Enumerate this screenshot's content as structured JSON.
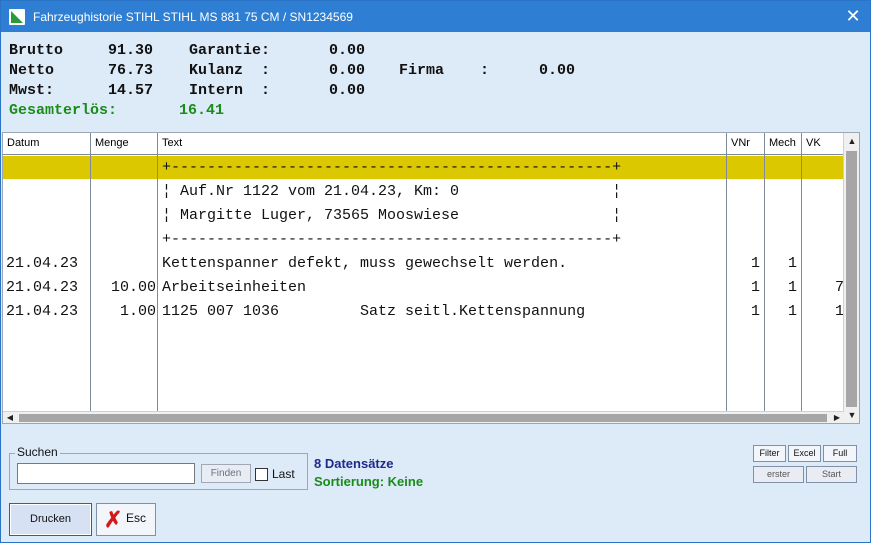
{
  "window": {
    "title": "Fahrzeughistorie STIHL STIHL MS 881 75 CM / SN1234569",
    "close_symbol": "✕"
  },
  "summary": {
    "brutto_label": "Brutto",
    "brutto_value": "91.30",
    "netto_label": "Netto",
    "netto_value": "76.73",
    "mwst_label": "Mwst:",
    "mwst_value": "14.57",
    "garantie_label": "Garantie:",
    "garantie_value": "0.00",
    "kulanz_label": "Kulanz  :",
    "kulanz_value": "0.00",
    "intern_label": "Intern  :",
    "intern_value": "0.00",
    "firma_label": "Firma    :",
    "firma_value": "0.00",
    "gesamterloes_label": "Gesamterlös:",
    "gesamterloes_value": "16.41"
  },
  "table": {
    "columns": [
      "Datum",
      "Menge",
      "Text",
      "VNr",
      "Mech",
      "VK"
    ],
    "rows": [
      {
        "datum": "",
        "menge": "",
        "text": "+-------------------------------------------------+",
        "vnr": "",
        "mech": "",
        "vk": ""
      },
      {
        "datum": "",
        "menge": "",
        "text": "¦ Auf.Nr 1122 vom 21.04.23, Km: 0                 ¦",
        "vnr": "",
        "mech": "",
        "vk": ""
      },
      {
        "datum": "",
        "menge": "",
        "text": "¦ Margitte Luger, 73565 Mooswiese                 ¦",
        "vnr": "",
        "mech": "",
        "vk": ""
      },
      {
        "datum": "",
        "menge": "",
        "text": "+-------------------------------------------------+",
        "vnr": "",
        "mech": "",
        "vk": ""
      },
      {
        "datum": "21.04.23",
        "menge": "",
        "text": "Kettenspanner defekt, muss gewechselt werden.",
        "vnr": "1",
        "mech": "1",
        "vk": ""
      },
      {
        "datum": "21.04.23",
        "menge": "10.00",
        "text": "Arbeitseinheiten",
        "vnr": "1",
        "mech": "1",
        "vk": "7"
      },
      {
        "datum": "21.04.23",
        "menge": "1.00",
        "text": "1125 007 1036         Satz seitl.Kettenspannung",
        "vnr": "1",
        "mech": "1",
        "vk": "1"
      }
    ]
  },
  "search": {
    "legend": "Suchen",
    "value": "",
    "finden_label": "Finden",
    "last_label": "Last"
  },
  "status": {
    "count": "8 Datensätze",
    "sort": "Sortierung: Keine"
  },
  "buttons": {
    "filter": "Filter",
    "excel": "Excel",
    "full": "Full",
    "erster": "erster",
    "start": "Start",
    "drucken": "Drucken",
    "esc": "Esc"
  },
  "colors": {
    "title_bar": "#2e7fd3",
    "window_bg": "#ddeaf8",
    "selected_row": "#dcc800",
    "green_text": "#1a8c1a",
    "status_blue": "#1e2a8c"
  }
}
